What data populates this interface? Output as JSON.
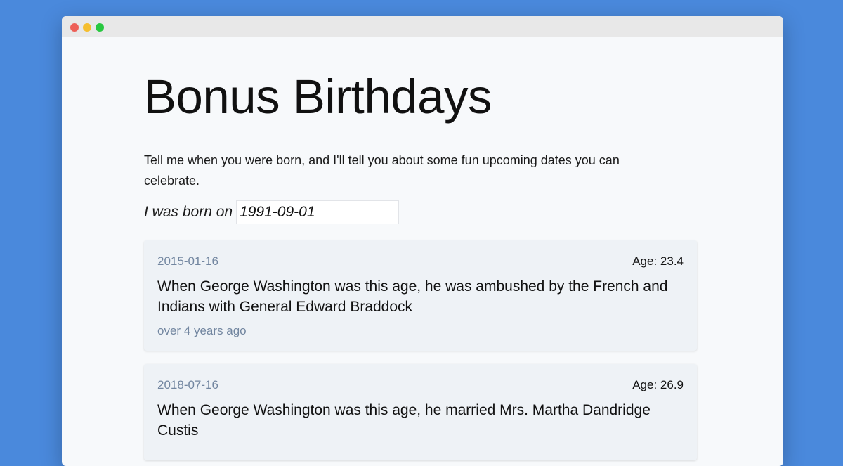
{
  "window": {
    "traffic_lights": {
      "close_color": "#ed5f57",
      "minimize_color": "#f5be2e",
      "maximize_color": "#28c840"
    }
  },
  "page": {
    "title": "Bonus Birthdays",
    "intro": "Tell me when you were born, and I'll tell you about some fun upcoming dates you can celebrate.",
    "born_label": "I was born on",
    "born_value": "1991-09-01"
  },
  "cards": [
    {
      "date": "2015-01-16",
      "age": "Age: 23.4",
      "text": "When George Washington was this age, he was ambushed by the French and Indians with General Edward Braddock",
      "relative": "over 4 years ago"
    },
    {
      "date": "2018-07-16",
      "age": "Age: 26.9",
      "text": "When George Washington was this age, he married Mrs. Martha Dandridge Custis",
      "relative": ""
    }
  ]
}
